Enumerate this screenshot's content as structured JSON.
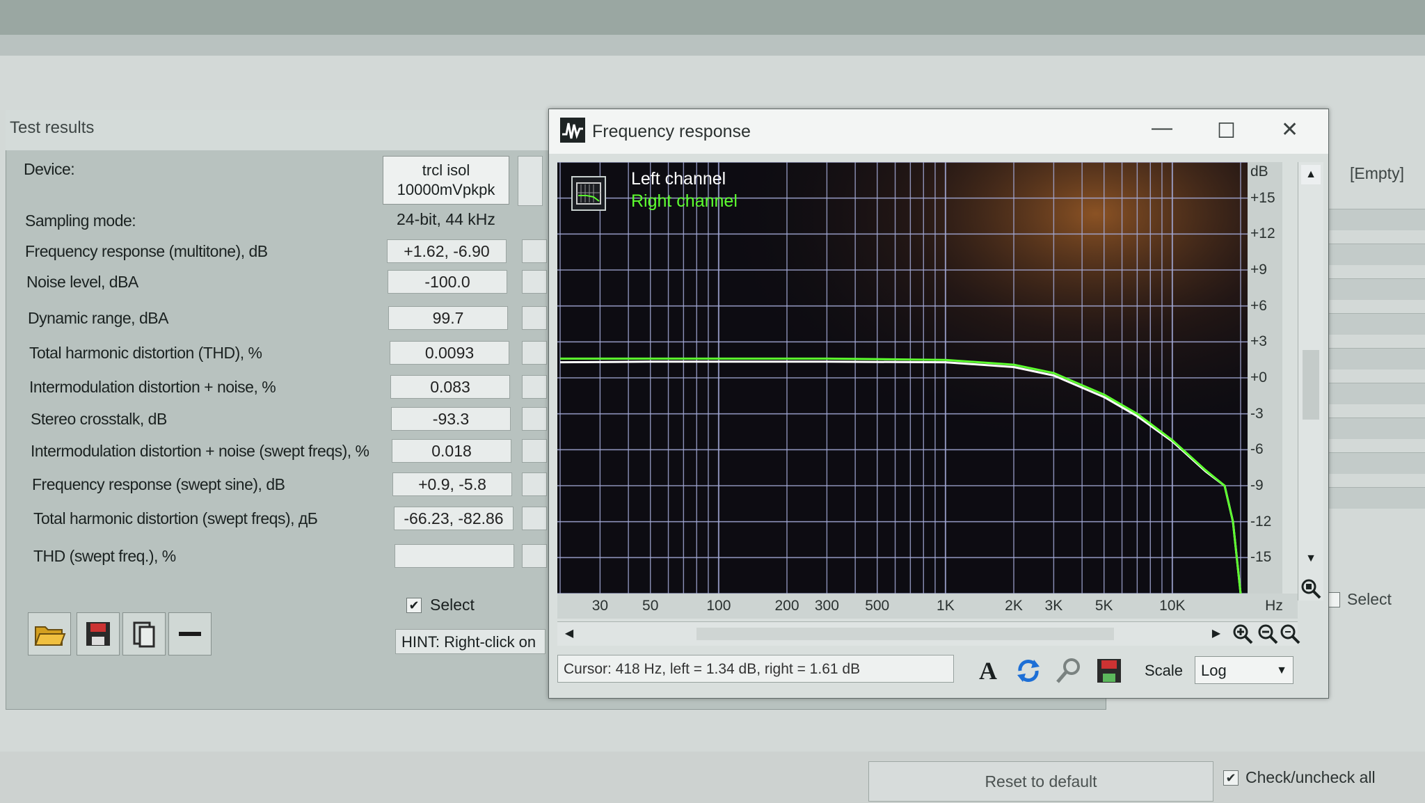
{
  "test_results": {
    "title": "Test results",
    "device_label": "Device:",
    "device_value_line1": "trcl isol",
    "device_value_line2": "10000mVpkpk",
    "sampling_label": "Sampling mode:",
    "sampling_value": "24-bit, 44 kHz",
    "rows": [
      {
        "label": "Frequency response (multitone), dB",
        "value": "+1.62, -6.90"
      },
      {
        "label": "Noise level, dBA",
        "value": "-100.0"
      },
      {
        "label": "Dynamic range, dBA",
        "value": "99.7"
      },
      {
        "label": "Total harmonic distortion (THD), %",
        "value": "0.0093"
      },
      {
        "label": "Intermodulation distortion + noise, %",
        "value": "0.083"
      },
      {
        "label": "Stereo crosstalk, dB",
        "value": "-93.3"
      },
      {
        "label": "Intermodulation distortion + noise (swept freqs), %",
        "value": "0.018"
      },
      {
        "label": "Frequency response (swept sine), dB",
        "value": "+0.9, -5.8"
      },
      {
        "label": "Total harmonic distortion (swept freqs), дБ",
        "value": "-66.23, -82.86"
      },
      {
        "label": "THD (swept freq.), %",
        "value": ""
      }
    ],
    "select_label": "Select",
    "hint": "HINT: Right-click on"
  },
  "freq_window": {
    "title": "Frequency response",
    "cursor_readout": "Cursor:  418 Hz,  left = 1.34 dB,  right = 1.61 dB",
    "scale_label": "Scale",
    "scale_value": "Log",
    "icons": [
      "font-icon",
      "refresh-icon",
      "zoom-tool-icon",
      "save-icon",
      "zoom-fit-icon",
      "zoom-in-icon",
      "zoom-out-icon"
    ]
  },
  "chart_data": {
    "type": "line",
    "title": "",
    "xlabel": "Hz",
    "ylabel": "dB",
    "x_scale": "log",
    "xlim": [
      20,
      20000
    ],
    "ylim": [
      -18,
      18
    ],
    "x_ticks": [
      {
        "value": 30,
        "label": "30"
      },
      {
        "value": 50,
        "label": "50"
      },
      {
        "value": 100,
        "label": "100"
      },
      {
        "value": 200,
        "label": "200"
      },
      {
        "value": 300,
        "label": "300"
      },
      {
        "value": 500,
        "label": "500"
      },
      {
        "value": 1000,
        "label": "1K"
      },
      {
        "value": 2000,
        "label": "2K"
      },
      {
        "value": 3000,
        "label": "3K"
      },
      {
        "value": 5000,
        "label": "5K"
      },
      {
        "value": 10000,
        "label": "10K"
      }
    ],
    "y_ticks": [
      {
        "value": 15,
        "label": "+15"
      },
      {
        "value": 12,
        "label": "+12"
      },
      {
        "value": 9,
        "label": "+9"
      },
      {
        "value": 6,
        "label": "+6"
      },
      {
        "value": 3,
        "label": "+3"
      },
      {
        "value": 0,
        "label": "+0"
      },
      {
        "value": -3,
        "label": "-3"
      },
      {
        "value": -6,
        "label": "-6"
      },
      {
        "value": -9,
        "label": "-9"
      },
      {
        "value": -12,
        "label": "-12"
      },
      {
        "value": -15,
        "label": "-15"
      }
    ],
    "series": [
      {
        "name": "Left channel",
        "color": "#ffffff",
        "x": [
          20,
          50,
          100,
          300,
          1000,
          2000,
          3000,
          5000,
          7000,
          10000,
          14000,
          17000,
          18500,
          20000
        ],
        "y": [
          1.3,
          1.35,
          1.35,
          1.35,
          1.3,
          0.9,
          0.2,
          -1.6,
          -3.2,
          -5.3,
          -7.8,
          -9.0,
          -12,
          -18
        ]
      },
      {
        "name": "Right channel",
        "color": "#5dff2f",
        "x": [
          20,
          50,
          100,
          300,
          1000,
          2000,
          3000,
          5000,
          7000,
          10000,
          14000,
          17000,
          18500,
          20000
        ],
        "y": [
          1.6,
          1.6,
          1.6,
          1.6,
          1.5,
          1.1,
          0.4,
          -1.4,
          -3.0,
          -5.2,
          -7.7,
          -9.0,
          -12,
          -18
        ]
      }
    ],
    "grid": true,
    "legend": "top-left",
    "background": "#0d0c12",
    "grid_color": "#a3a9d6"
  },
  "right_panel": {
    "empty_label": "[Empty]",
    "select_label": "Select"
  },
  "bottom": {
    "reset_label": "Reset to default",
    "check_all_label": "Check/uncheck all"
  }
}
